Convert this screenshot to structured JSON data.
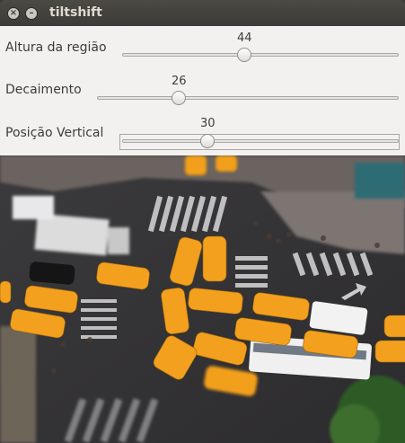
{
  "window": {
    "title": "tiltshift"
  },
  "sliders": [
    {
      "label": "Altura da região",
      "value": "44",
      "fraction": 0.44
    },
    {
      "label": "Decaimento",
      "value": "26",
      "fraction": 0.26
    },
    {
      "label": "Posição Vertical",
      "value": "30",
      "fraction": 0.3
    }
  ],
  "photo": {
    "description_icon": "city-intersection-image"
  }
}
